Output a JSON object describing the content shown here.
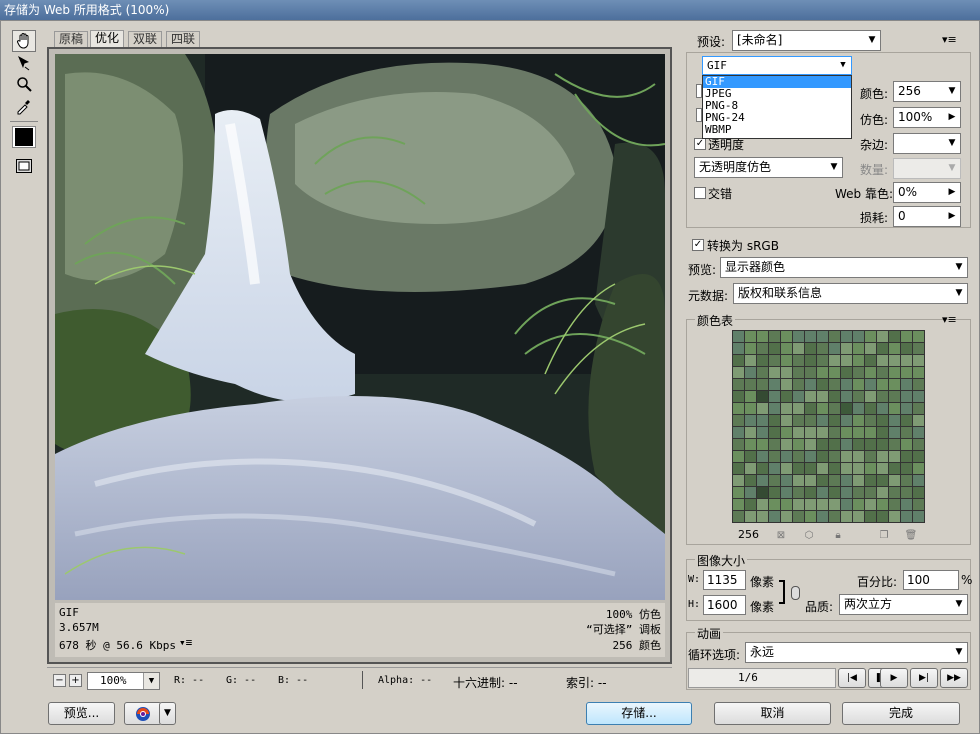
{
  "window": {
    "title": "存储为 Web 所用格式 (100%)"
  },
  "tabs": [
    "原稿",
    "优化",
    "双联",
    "四联"
  ],
  "image_info": {
    "format": "GIF",
    "size": "3.657M",
    "speed": "678 秒 @ 56.6 Kbps",
    "zoom_pct": "100% 仿色",
    "palette": "“可选择” 调板",
    "colors": "256 颜色"
  },
  "statusbar": {
    "zoom": "100%",
    "r": "R: --",
    "g": "G: --",
    "b": "B: --",
    "alpha": "Alpha: --",
    "hex": "十六进制: --",
    "index": "索引: --"
  },
  "buttons": {
    "preview": "预览...",
    "save": "存储...",
    "cancel": "取消",
    "done": "完成"
  },
  "settings": {
    "preset_label": "预设:",
    "preset_value": "[未命名]",
    "format_value": "GIF",
    "format_options": [
      "GIF",
      "JPEG",
      "PNG-8",
      "PNG-24",
      "WBMP"
    ],
    "colors_label": "颜色:",
    "colors_value": "256",
    "dither_label": "仿色:",
    "dither_value": "100%",
    "matte_label": "杂边:",
    "matte_value": "",
    "transparency_label": "透明度",
    "transparency_dither": "无透明度仿色",
    "amount_label": "数量:",
    "interlaced_label": "交错",
    "websnap_label": "Web 靠色:",
    "websnap_value": "0%",
    "lossy_label": "损耗:",
    "lossy_value": "0",
    "convert_srgb": "转换为 sRGB",
    "preview_label": "预览:",
    "preview_value": "显示器颜色",
    "metadata_label": "元数据:",
    "metadata_value": "版权和联系信息"
  },
  "color_table": {
    "title": "颜色表",
    "count": "256"
  },
  "image_size": {
    "title": "图像大小",
    "w_label": "W:",
    "w_value": "1135",
    "w_unit": "像素",
    "h_label": "H:",
    "h_value": "1600",
    "h_unit": "像素",
    "percent_label": "百分比:",
    "percent_value": "100",
    "percent_unit": "%",
    "quality_label": "品质:",
    "quality_value": "两次立方"
  },
  "animation": {
    "title": "动画",
    "loop_label": "循环选项:",
    "loop_value": "永远",
    "frame": "1/6"
  },
  "colors": {
    "accent": "#3399ff",
    "title_bar": "#5a7aa6"
  }
}
